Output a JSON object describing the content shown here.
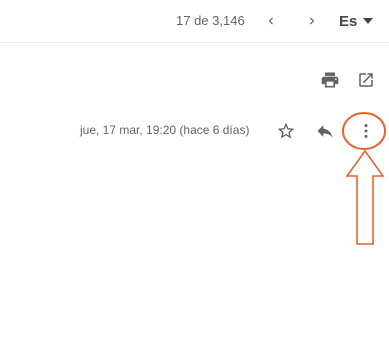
{
  "toolbar": {
    "pager_text": "17 de 3,146",
    "language_label": "Es",
    "icons": {
      "prev": "chevron-left-icon",
      "next": "chevron-right-icon",
      "lang_caret": "caret-down-icon"
    }
  },
  "message": {
    "date_text": "jue, 17 mar, 19:20 (hace 6 días)",
    "icons": {
      "print": "print-icon",
      "popout": "open-in-new-window-icon",
      "star": "star-outline-icon",
      "reply": "reply-icon",
      "more": "more-vertical-icon"
    }
  },
  "annotation": {
    "color": "#e8622a",
    "shapes": [
      "highlight-ellipse",
      "up-arrow"
    ]
  },
  "colors": {
    "icon": "#5f6368",
    "text_secondary": "#5f6368",
    "annotation": "#e8622a"
  }
}
